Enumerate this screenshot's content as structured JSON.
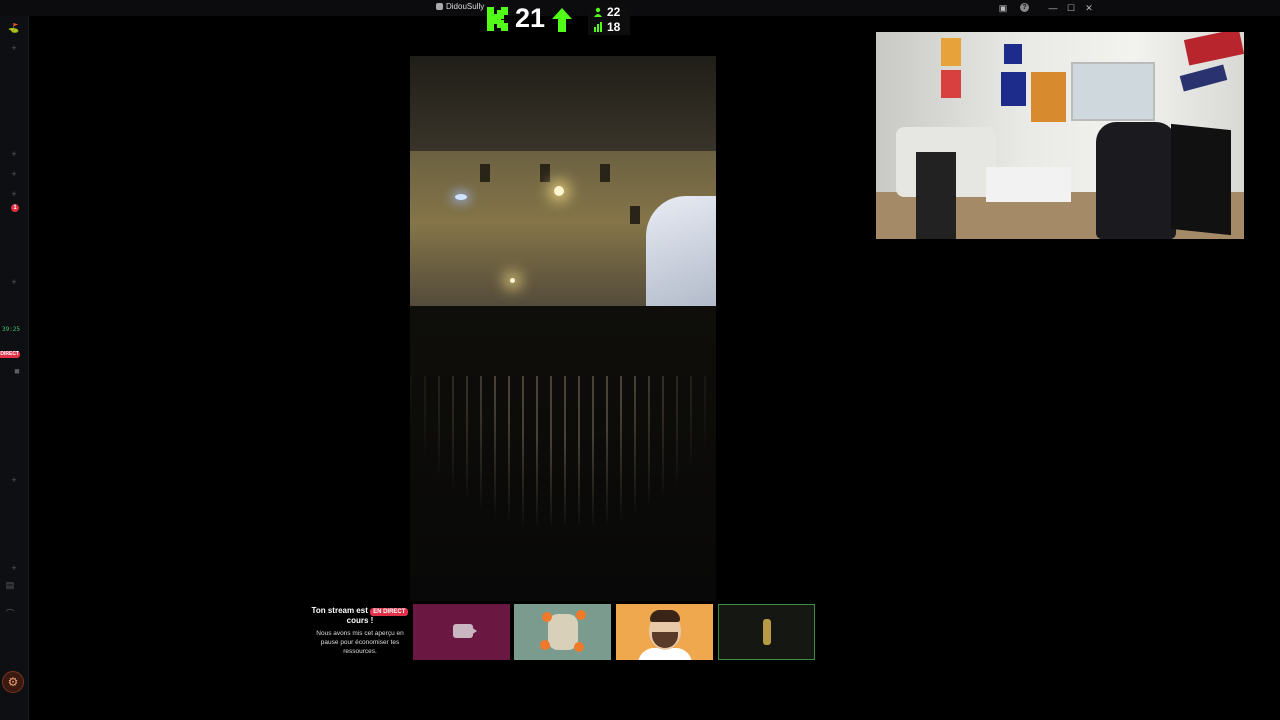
{
  "titlebar": {
    "channel_name": "DidouSully",
    "controls": [
      "inbox-icon",
      "help-icon",
      "minimize-icon",
      "maximize-icon",
      "close-icon"
    ],
    "help_glyph": "?",
    "minimize_glyph": "—",
    "maximize_glyph": "☐",
    "close_glyph": "✕"
  },
  "kick_badge": {
    "count": "21",
    "stats": [
      {
        "icon": "viewers-icon",
        "value": "22"
      },
      {
        "icon": "bar-chart-icon",
        "value": "18"
      }
    ],
    "accent": "#53fc18"
  },
  "sidebar": {
    "items": [
      {
        "icon": "user-icon",
        "glyph": "⛳"
      },
      {
        "icon": "plus-icon",
        "glyph": "+"
      }
    ],
    "badge_count": "1",
    "timer": "39:25",
    "live_label": "DIRECT",
    "plus_glyph": "+",
    "cam_glyph": "■"
  },
  "bottom": {
    "notice_title_before": "Ton stream est ",
    "notice_live_pill": "EN DIRECT",
    "notice_title_after": " cours !",
    "notice_desc": "Nous avons mis cet aperçu en pause pour économiser tes ressources."
  },
  "colors": {
    "live_red": "#e0334a",
    "kick_green": "#53fc18",
    "tile_purple": "#6a1842",
    "tile_orange": "#f0a84e",
    "tile_sage": "#7a9b8d"
  }
}
